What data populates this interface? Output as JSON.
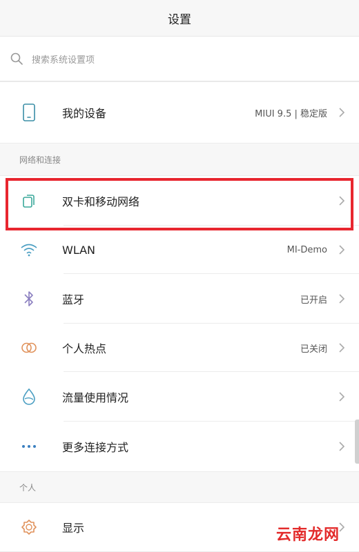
{
  "header": {
    "title": "设置"
  },
  "search": {
    "placeholder": "搜索系统设置项"
  },
  "device": {
    "label": "我的设备",
    "value": "MIUI 9.5 | 稳定版"
  },
  "network_section": {
    "title": "网络和连接",
    "items": [
      {
        "label": "双卡和移动网络",
        "value": "",
        "icon": "dual-sim-icon"
      },
      {
        "label": "WLAN",
        "value": "MI-Demo",
        "icon": "wifi-icon"
      },
      {
        "label": "蓝牙",
        "value": "已开启",
        "icon": "bluetooth-icon"
      },
      {
        "label": "个人热点",
        "value": "已关闭",
        "icon": "hotspot-icon"
      },
      {
        "label": "流量使用情况",
        "value": "",
        "icon": "data-usage-icon"
      },
      {
        "label": "更多连接方式",
        "value": "",
        "icon": "more-icon"
      }
    ]
  },
  "personal_section": {
    "title": "个人",
    "items": [
      {
        "label": "显示",
        "icon": "display-icon"
      }
    ]
  },
  "watermark": "云南龙网",
  "colors": {
    "accent": "#3a8ea6",
    "highlight": "#e8262f",
    "watermark": "#e32b2b"
  }
}
